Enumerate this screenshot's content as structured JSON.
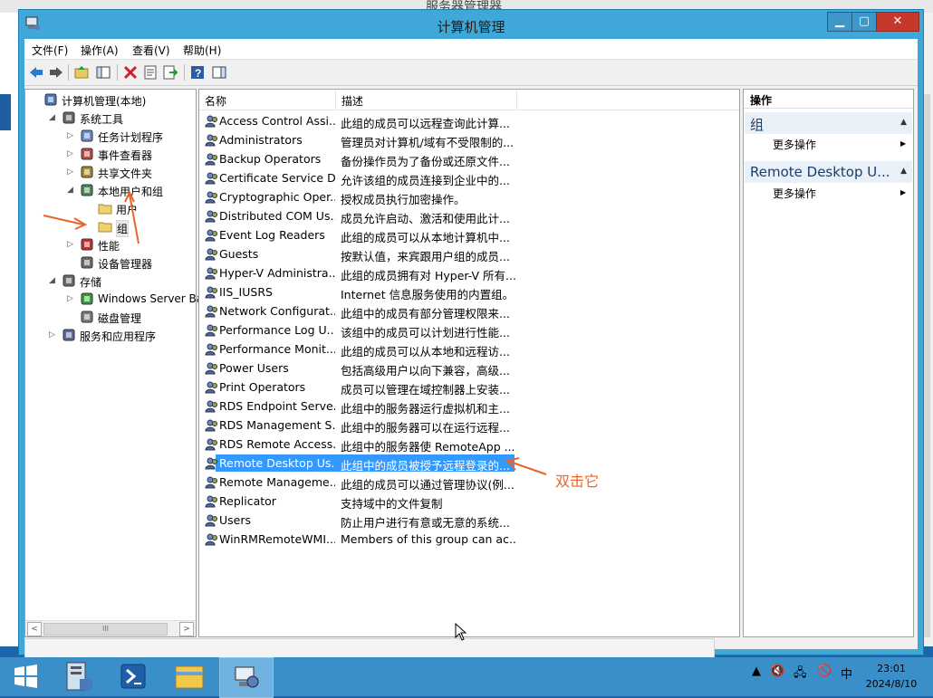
{
  "background": {
    "top_title": "服务器管理器"
  },
  "window": {
    "title": "计算机管理",
    "min_label": "▁",
    "max_label": "▢",
    "close_label": "✕"
  },
  "menu": [
    "文件(F)",
    "操作(A)",
    "查看(V)",
    "帮助(H)"
  ],
  "toolbar_icons": [
    "back-icon",
    "forward-icon",
    "up-folder-icon",
    "show-hide-tree-icon",
    "delete-icon",
    "properties-icon",
    "export-list-icon",
    "help-icon",
    "show-hide-action-icon"
  ],
  "tree": [
    {
      "label": "计算机管理(本地)",
      "level": 0,
      "exp": "",
      "icon": "computer-management-icon"
    },
    {
      "label": "系统工具",
      "level": 1,
      "exp": "◢",
      "icon": "system-tools-icon"
    },
    {
      "label": "任务计划程序",
      "level": 2,
      "exp": "▷",
      "icon": "task-scheduler-icon"
    },
    {
      "label": "事件查看器",
      "level": 2,
      "exp": "▷",
      "icon": "event-viewer-icon"
    },
    {
      "label": "共享文件夹",
      "level": 2,
      "exp": "▷",
      "icon": "shared-folders-icon"
    },
    {
      "label": "本地用户和组",
      "level": 2,
      "exp": "◢",
      "icon": "local-users-groups-icon"
    },
    {
      "label": "用户",
      "level": 3,
      "exp": "",
      "icon": "folder-icon"
    },
    {
      "label": "组",
      "level": 3,
      "exp": "",
      "icon": "folder-icon",
      "selected": true
    },
    {
      "label": "性能",
      "level": 2,
      "exp": "▷",
      "icon": "performance-icon"
    },
    {
      "label": "设备管理器",
      "level": 2,
      "exp": "",
      "icon": "device-manager-icon"
    },
    {
      "label": "存储",
      "level": 1,
      "exp": "◢",
      "icon": "storage-icon"
    },
    {
      "label": "Windows Server Back",
      "level": 2,
      "exp": "▷",
      "icon": "windows-backup-icon"
    },
    {
      "label": "磁盘管理",
      "level": 2,
      "exp": "",
      "icon": "disk-management-icon"
    },
    {
      "label": "服务和应用程序",
      "level": 1,
      "exp": "▷",
      "icon": "services-apps-icon"
    }
  ],
  "tree_scroll_thumb": "III",
  "columns": {
    "name": "名称",
    "desc": "描述"
  },
  "groups": [
    {
      "name": "Access Control Assi...",
      "desc": "此组的成员可以远程查询此计算..."
    },
    {
      "name": "Administrators",
      "desc": "管理员对计算机/域有不受限制的..."
    },
    {
      "name": "Backup Operators",
      "desc": "备份操作员为了备份或还原文件..."
    },
    {
      "name": "Certificate Service D...",
      "desc": "允许该组的成员连接到企业中的..."
    },
    {
      "name": "Cryptographic Oper...",
      "desc": "授权成员执行加密操作。"
    },
    {
      "name": "Distributed COM Us...",
      "desc": "成员允许启动、激活和使用此计..."
    },
    {
      "name": "Event Log Readers",
      "desc": "此组的成员可以从本地计算机中..."
    },
    {
      "name": "Guests",
      "desc": "按默认值，来宾跟用户组的成员..."
    },
    {
      "name": "Hyper-V Administra...",
      "desc": "此组的成员拥有对 Hyper-V 所有..."
    },
    {
      "name": "IIS_IUSRS",
      "desc": "Internet 信息服务使用的内置组。"
    },
    {
      "name": "Network Configurat...",
      "desc": "此组中的成员有部分管理权限来..."
    },
    {
      "name": "Performance Log U...",
      "desc": "该组中的成员可以计划进行性能..."
    },
    {
      "name": "Performance Monit...",
      "desc": "此组的成员可以从本地和远程访..."
    },
    {
      "name": "Power Users",
      "desc": "包括高级用户以向下兼容，高级..."
    },
    {
      "name": "Print Operators",
      "desc": "成员可以管理在域控制器上安装..."
    },
    {
      "name": "RDS Endpoint Serve...",
      "desc": "此组中的服务器运行虚拟机和主..."
    },
    {
      "name": "RDS Management S...",
      "desc": "此组中的服务器可以在运行远程..."
    },
    {
      "name": "RDS Remote Access...",
      "desc": "此组中的服务器使 RemoteApp ..."
    },
    {
      "name": "Remote Desktop Us...",
      "desc": "此组中的成员被授予远程登录的...",
      "selected": true
    },
    {
      "name": "Remote Manageme...",
      "desc": "此组的成员可以通过管理协议(例..."
    },
    {
      "name": "Replicator",
      "desc": "支持域中的文件复制"
    },
    {
      "name": "Users",
      "desc": "防止用户进行有意或无意的系统..."
    },
    {
      "name": "WinRMRemoteWMI...",
      "desc": "Members of this group can ac..."
    }
  ],
  "actions": {
    "header": "操作",
    "sections": [
      {
        "title": "组",
        "item": "更多操作"
      },
      {
        "title": "Remote Desktop U...",
        "item": "更多操作"
      }
    ]
  },
  "annotation": {
    "text": "双击它",
    "color": "#e8652b"
  },
  "taskbar": {
    "apps": [
      "start-icon",
      "server-manager-icon",
      "powershell-icon",
      "file-explorer-icon",
      "computer-management-icon"
    ],
    "tray": [
      "▲",
      "🔇",
      "🖧",
      "🚫",
      "中"
    ],
    "time": "23:01",
    "date": "2024/8/10"
  }
}
